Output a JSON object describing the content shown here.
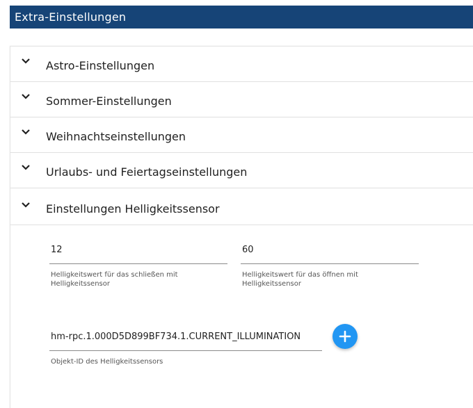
{
  "header": {
    "title": "Extra-Einstellungen"
  },
  "accordion": [
    {
      "label": "Astro-Einstellungen",
      "icon": "chevron-down-icon"
    },
    {
      "label": "Sommer-Einstellungen",
      "icon": "chevron-down-icon"
    },
    {
      "label": "Weihnachtseinstellungen",
      "icon": "chevron-down-icon"
    },
    {
      "label": "Urlaubs- und Feiertagseinstellungen",
      "icon": "chevron-down-icon"
    },
    {
      "label": "Einstellungen Helligkeitssensor",
      "icon": "chevron-down-icon"
    }
  ],
  "brightness": {
    "close_value": "12",
    "close_label": "Helligkeitswert für das schließen mit Helligkeitssensor",
    "open_value": "60",
    "open_label": "Helligkeitswert für das öffnen mit Helligkeitssensor",
    "object_id_value": "hm-rpc.1.000D5D899BF734.1.CURRENT_ILLUMINATION",
    "object_id_label": "Objekt-ID des Helligkeitssensors",
    "add_icon": "plus-icon"
  },
  "colors": {
    "header_bg": "#164477",
    "accent": "#2196f3"
  }
}
